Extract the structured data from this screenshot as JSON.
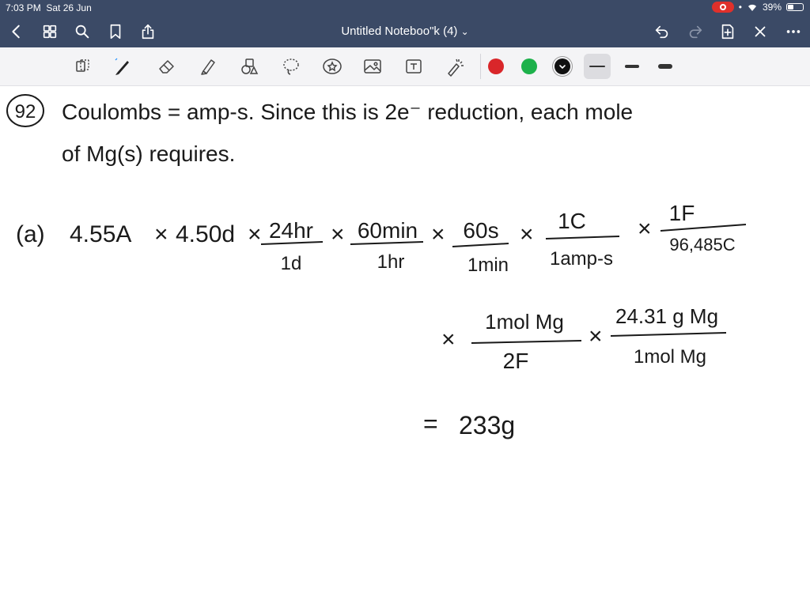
{
  "status_bar": {
    "time": "7:03 PM",
    "date": "Sat 26 Jun",
    "battery": "39%",
    "battery_level": 0.39
  },
  "nav_bar": {
    "title": "Untitled Noteboo\"k (4)",
    "title_chevron": "⌄",
    "icons": [
      "back-icon",
      "grid-icon",
      "search-icon",
      "bookmark-icon",
      "share-icon",
      "undo-icon",
      "redo-icon",
      "add-page-icon",
      "close-icon",
      "more-icon"
    ]
  },
  "toolbar": {
    "tools": [
      "lasso-select-icon",
      "pen-icon",
      "eraser-icon",
      "highlighter-icon",
      "shapes-icon",
      "lasso-icon",
      "sticker-icon",
      "image-icon",
      "text-icon",
      "laser-pointer-icon"
    ],
    "colors": [
      "#d9262a",
      "#1db14b",
      "#111111"
    ],
    "selected_color": "#111111",
    "thickness_options": [
      "thin",
      "medium",
      "thick"
    ],
    "selected_thickness": "thin"
  },
  "note": {
    "problem_number": "92",
    "line1": "Coulombs = amp-s. Since this is 2e⁻ reduction, each mole",
    "line2": "of Mg(s) requires.",
    "part_label": "(a)",
    "term1": "4.55A",
    "term2": "4.50d",
    "times": "×",
    "f1_num": "24hr",
    "f1_den": "1d",
    "f2_num": "60min",
    "f2_den": "1hr",
    "f3_num": "60s",
    "f3_den": "1min",
    "f4_num": "1C",
    "f4_den": "1amp-s",
    "f5_num": "1F",
    "f5_den": "96,485C",
    "f6_num": "1mol Mg",
    "f6_den": "2F",
    "f7_num": "24.31 g Mg",
    "f7_den": "1mol Mg",
    "equals": "=",
    "result": "233g"
  }
}
